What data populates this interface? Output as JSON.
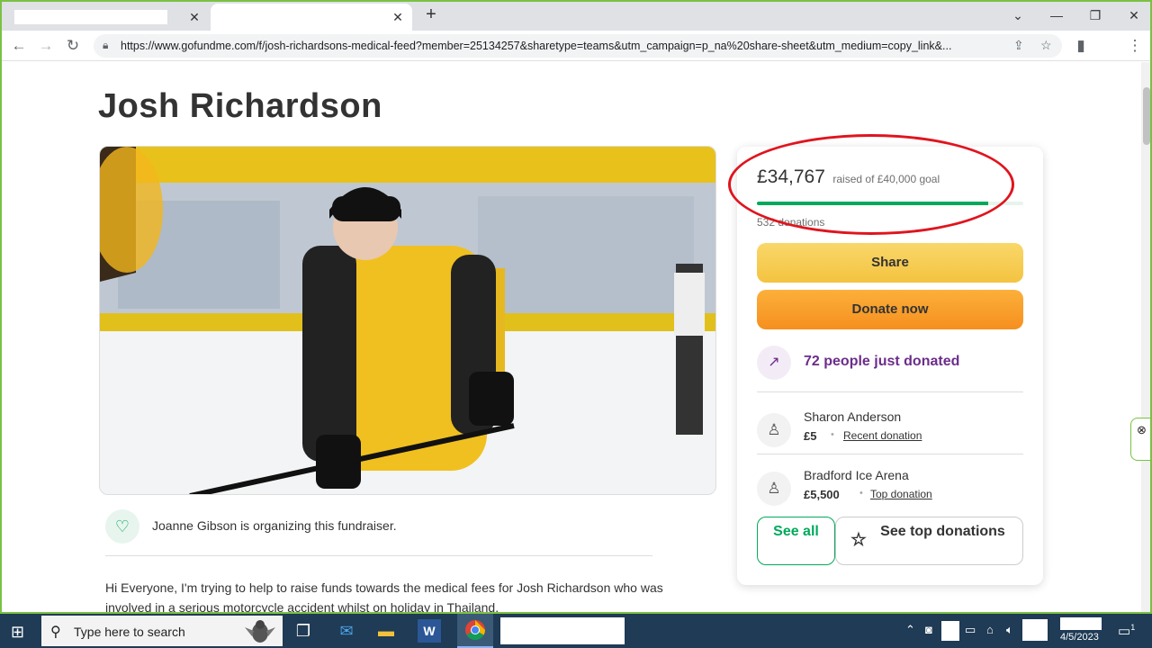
{
  "browser": {
    "new_tab_label": "+",
    "tab_close": "✕",
    "url": "https://www.gofundme.com/f/josh-richardsons-medical-feed?member=25134257&sharetype=teams&utm_campaign=p_na%20share-sheet&utm_medium=copy_link&..."
  },
  "page": {
    "title": "Josh Richardson",
    "organizer_text": "Joanne Gibson is organizing this fundraiser.",
    "story": "Hi Everyone, I'm trying to help to raise funds towards the medical fees for Josh Richardson who was involved in a serious motorcycle accident whilst on holiday in Thailand."
  },
  "campaign": {
    "amount": "£34,767",
    "goal_text": "raised of £40,000 goal",
    "progress_fraction": 0.869,
    "donations_count": "532 donations",
    "share_label": "Share",
    "donate_label": "Donate now",
    "trend_text": "72 people just donated",
    "donors": [
      {
        "name": "Sharon Anderson",
        "amount": "£5",
        "tag": "Recent donation"
      },
      {
        "name": "Bradford Ice Arena",
        "amount": "£5,500",
        "tag": "Top donation"
      }
    ],
    "see_all_label": "See all",
    "see_top_label": "See top donations"
  },
  "taskbar": {
    "search_placeholder": "Type here to search",
    "date": "4/5/2023",
    "notification_count": "1"
  },
  "colors": {
    "brand_green": "#02a95c",
    "share_yellow": "#f4c340",
    "donate_orange": "#f68f1e",
    "trend_purple": "#6b2d8a",
    "annotation_red": "#e0141e",
    "taskbar": "#1f3b55"
  },
  "icons": [
    "back-icon",
    "forward-icon",
    "reload-icon",
    "lock-icon",
    "share-page-icon",
    "bookmark-star-icon",
    "side-panel-icon",
    "menu-dots-icon",
    "trend-up-icon",
    "donor-icon",
    "star-icon",
    "windows-start-icon",
    "search-icon",
    "task-view-icon",
    "mail-icon",
    "file-explorer-icon",
    "word-icon",
    "chrome-icon"
  ]
}
